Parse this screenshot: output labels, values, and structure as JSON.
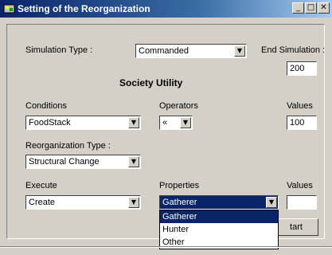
{
  "window": {
    "title": "Setting of the Reorganization",
    "minimize": "_",
    "maximize": "□",
    "close": "✕"
  },
  "simulation": {
    "label": "Simulation Type :",
    "value": "Commanded"
  },
  "end_simulation": {
    "label": "End Simulation :",
    "value": "200"
  },
  "section_title": "Society Utility",
  "conditions": {
    "label": "Conditions",
    "value": "FoodStack"
  },
  "operators": {
    "label": "Operators",
    "value": "«"
  },
  "values1": {
    "label": "Values",
    "value": "100"
  },
  "reorg": {
    "label": "Reorganization Type :",
    "value": "Structural Change"
  },
  "execute": {
    "label": "Execute",
    "value": "Create"
  },
  "properties": {
    "label": "Properties",
    "value": "Gatherer",
    "options": [
      "Gatherer",
      "Hunter",
      "Other"
    ]
  },
  "values2": {
    "label": "Values",
    "value": ""
  },
  "start_button": "tart",
  "arrow_glyph": "▼"
}
